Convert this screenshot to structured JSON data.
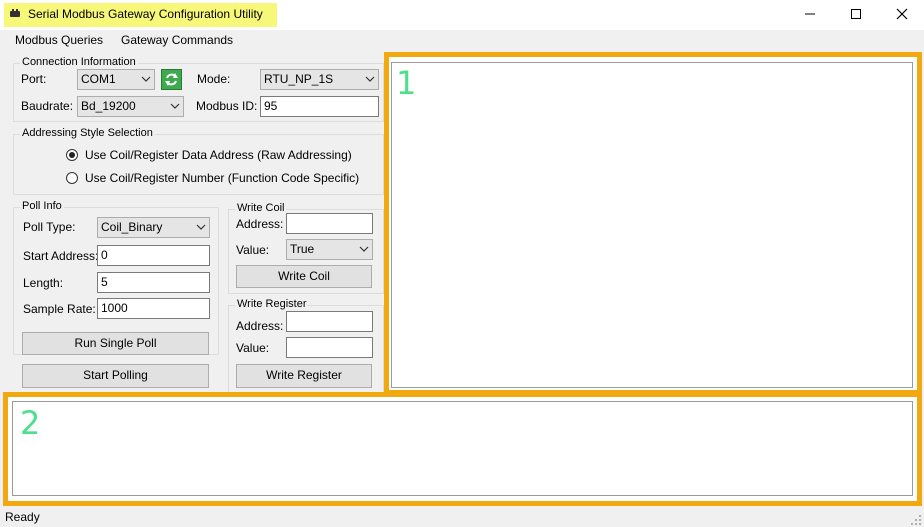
{
  "window": {
    "title": "Serial Modbus Gateway Configuration Utility",
    "app_icon": "serial-device-icon",
    "title_highlight_color": "#f7f77a",
    "controls": {
      "minimize": "minimize-icon",
      "maximize": "maximize-icon",
      "close": "close-icon"
    }
  },
  "menu": {
    "items": [
      "Modbus Queries",
      "Gateway Commands"
    ]
  },
  "connection": {
    "legend": "Connection Information",
    "port_label": "Port:",
    "port_value": "COM1",
    "refresh_icon": "refresh-icon",
    "mode_label": "Mode:",
    "mode_value": "RTU_NP_1S",
    "baud_label": "Baudrate:",
    "baud_value": "Bd_19200",
    "modbus_id_label": "Modbus ID:",
    "modbus_id_value": "95"
  },
  "addressing": {
    "legend": "Addressing Style Selection",
    "options": [
      {
        "label": "Use Coil/Register Data Address (Raw Addressing)",
        "selected": true
      },
      {
        "label": "Use Coil/Register Number (Function Code Specific)",
        "selected": false
      }
    ]
  },
  "poll": {
    "legend": "Poll Info",
    "poll_type_label": "Poll Type:",
    "poll_type_value": "Coil_Binary",
    "start_address_label": "Start Address:",
    "start_address_value": "0",
    "length_label": "Length:",
    "length_value": "5",
    "sample_rate_label": "Sample Rate:",
    "sample_rate_value": "1000",
    "run_single_label": "Run Single Poll",
    "start_polling_label": "Start Polling"
  },
  "write_coil": {
    "legend": "Write Coil",
    "address_label": "Address:",
    "address_value": "",
    "value_label": "Value:",
    "value_value": "True",
    "button_label": "Write Coil"
  },
  "write_register": {
    "legend": "Write Register",
    "address_label": "Address:",
    "address_value": "",
    "value_label": "Value:",
    "value_value": "",
    "button_label": "Write Register"
  },
  "panels": {
    "highlight_color": "#f2a90f",
    "number_color": "#4de08c",
    "panel1_number": "1",
    "panel2_number": "2"
  },
  "status_bar": {
    "text": "Ready"
  }
}
